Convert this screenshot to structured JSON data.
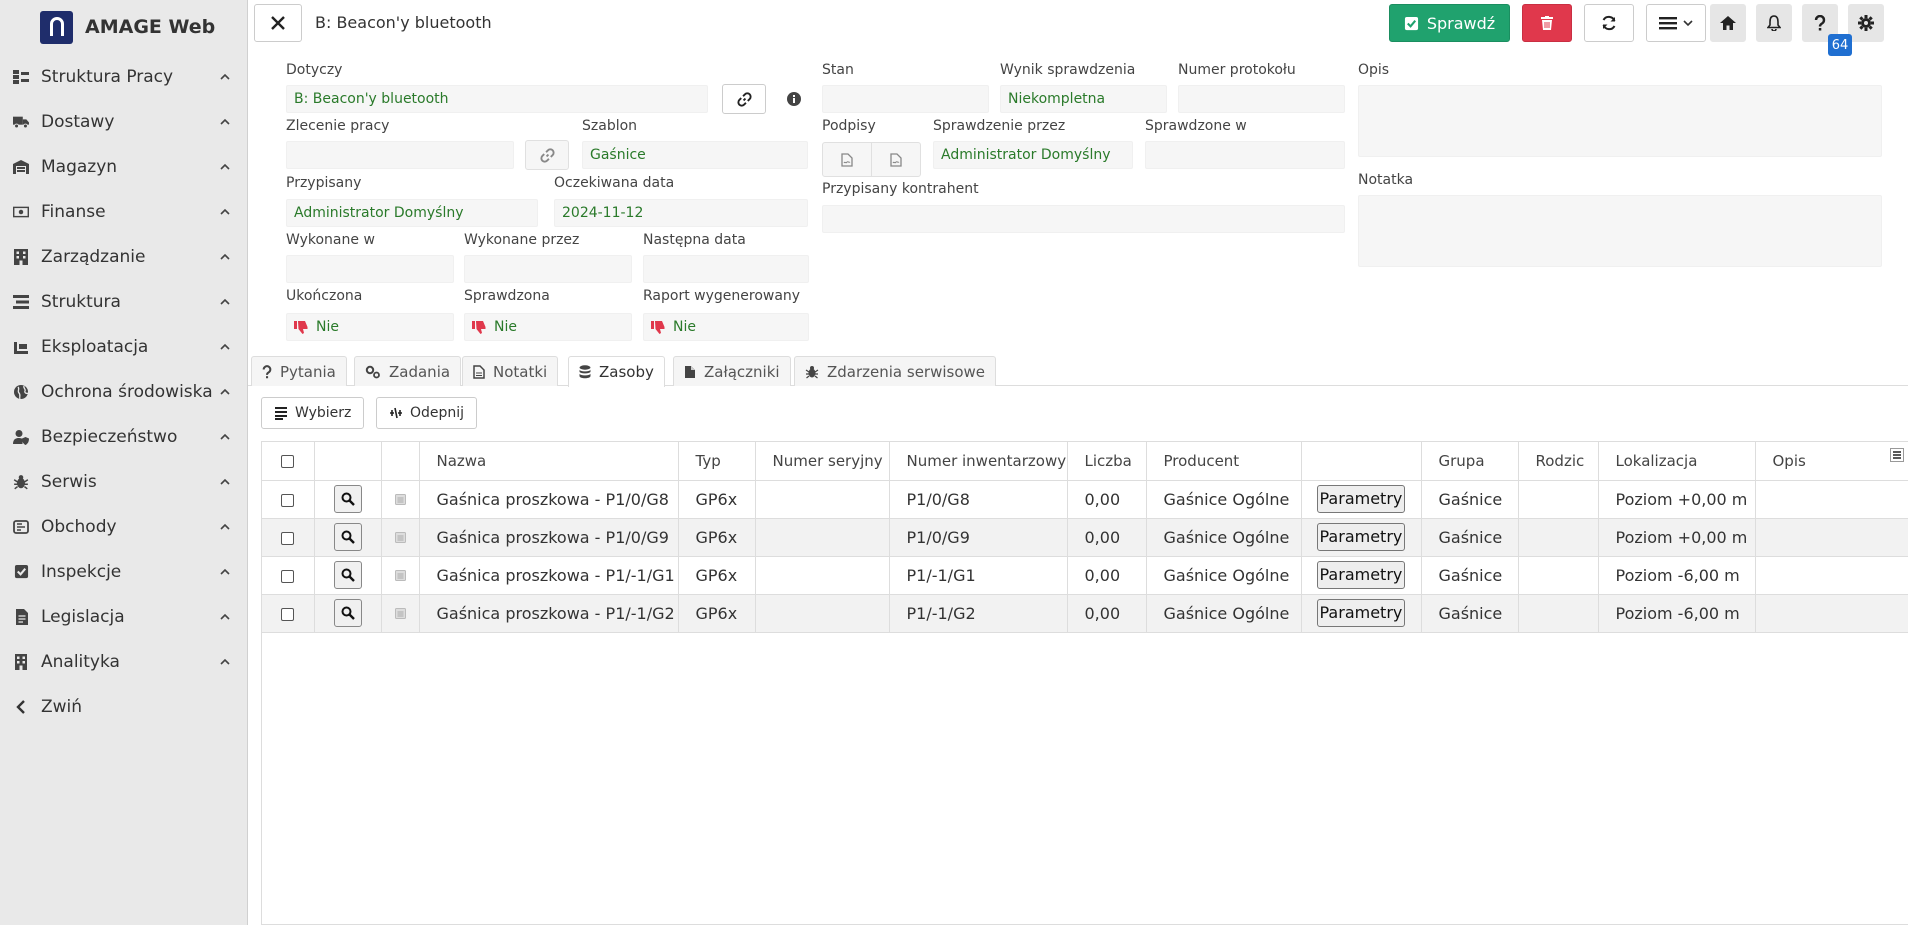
{
  "app": {
    "brand": "AMAGE Web"
  },
  "sidebar": {
    "items": [
      {
        "label": "Struktura Pracy",
        "icon": "sitemap-icon"
      },
      {
        "label": "Dostawy",
        "icon": "truck-icon"
      },
      {
        "label": "Magazyn",
        "icon": "warehouse-icon"
      },
      {
        "label": "Finanse",
        "icon": "money-icon"
      },
      {
        "label": "Zarządzanie",
        "icon": "building-icon"
      },
      {
        "label": "Struktura",
        "icon": "layers-icon"
      },
      {
        "label": "Eksploatacja",
        "icon": "gauge-icon"
      },
      {
        "label": "Ochrona środowiska",
        "icon": "globe-icon"
      },
      {
        "label": "Bezpieczeństwo",
        "icon": "user-shield-icon"
      },
      {
        "label": "Serwis",
        "icon": "bug-icon"
      },
      {
        "label": "Obchody",
        "icon": "route-icon"
      },
      {
        "label": "Inspekcje",
        "icon": "check-square-icon"
      },
      {
        "label": "Legislacja",
        "icon": "book-icon"
      },
      {
        "label": "Analityka",
        "icon": "chart-building-icon"
      }
    ],
    "collapse_label": "Zwiń"
  },
  "header": {
    "title": "B: Beacon'y bluetooth",
    "check_label": "Sprawdź",
    "badge_count": "64"
  },
  "form": {
    "dotyczy": {
      "label": "Dotyczy",
      "value": "B: Beacon'y bluetooth"
    },
    "zlecenie": {
      "label": "Zlecenie pracy",
      "value": ""
    },
    "szablon": {
      "label": "Szablon",
      "value": "Gaśnice"
    },
    "przypisany": {
      "label": "Przypisany",
      "value": "Administrator Domyślny"
    },
    "oczekiwana": {
      "label": "Oczekiwana data",
      "value": "2024-11-12"
    },
    "wykonane_w": {
      "label": "Wykonane w",
      "value": ""
    },
    "wykonane_przez": {
      "label": "Wykonane przez",
      "value": ""
    },
    "nastepna": {
      "label": "Następna data",
      "value": ""
    },
    "ukonczona": {
      "label": "Ukończona",
      "value": "Nie"
    },
    "sprawdzona": {
      "label": "Sprawdzona",
      "value": "Nie"
    },
    "raport": {
      "label": "Raport wygenerowany",
      "value": "Nie"
    },
    "stan": {
      "label": "Stan",
      "value": ""
    },
    "wynik": {
      "label": "Wynik sprawdzenia",
      "value": "Niekompletna"
    },
    "numer_protokolu": {
      "label": "Numer protokołu",
      "value": ""
    },
    "podpisy": {
      "label": "Podpisy"
    },
    "sprawdzenie_przez": {
      "label": "Sprawdzenie przez",
      "value": "Administrator Domyślny"
    },
    "sprawdzone_w": {
      "label": "Sprawdzone w",
      "value": ""
    },
    "kontrahent": {
      "label": "Przypisany kontrahent",
      "value": ""
    },
    "opis": {
      "label": "Opis",
      "value": ""
    },
    "notatka": {
      "label": "Notatka",
      "value": ""
    }
  },
  "tabs": [
    {
      "label": "Pytania",
      "icon": "question-icon"
    },
    {
      "label": "Zadania",
      "icon": "cogs-icon"
    },
    {
      "label": "Notatki",
      "icon": "file-text-icon"
    },
    {
      "label": "Zasoby",
      "icon": "database-icon",
      "active": true
    },
    {
      "label": "Załączniki",
      "icon": "file-icon"
    },
    {
      "label": "Zdarzenia serwisowe",
      "icon": "bug-icon"
    }
  ],
  "toolbar": {
    "select_label": "Wybierz",
    "unpin_label": "Odepnij"
  },
  "table": {
    "columns": [
      "Nazwa",
      "Typ",
      "Numer seryjny",
      "Numer inwentarzowy",
      "Liczba",
      "Producent",
      "",
      "Grupa",
      "Rodzic",
      "Lokalizacja",
      "Opis"
    ],
    "param_label": "Parametry",
    "rows": [
      {
        "nazwa": "Gaśnica proszkowa - P1/0/G8",
        "typ": "GP6x",
        "seryjny": "",
        "inwentarzowy": "P1/0/G8",
        "liczba": "0,00",
        "producent": "Gaśnice Ogólne",
        "grupa": "Gaśnice",
        "rodzic": "",
        "lokalizacja": "Poziom +0,00 m",
        "opis": ""
      },
      {
        "nazwa": "Gaśnica proszkowa - P1/0/G9",
        "typ": "GP6x",
        "seryjny": "",
        "inwentarzowy": "P1/0/G9",
        "liczba": "0,00",
        "producent": "Gaśnice Ogólne",
        "grupa": "Gaśnice",
        "rodzic": "",
        "lokalizacja": "Poziom +0,00 m",
        "opis": ""
      },
      {
        "nazwa": "Gaśnica proszkowa - P1/-1/G1",
        "typ": "GP6x",
        "seryjny": "",
        "inwentarzowy": "P1/-1/G1",
        "liczba": "0,00",
        "producent": "Gaśnice Ogólne",
        "grupa": "Gaśnice",
        "rodzic": "",
        "lokalizacja": "Poziom -6,00 m",
        "opis": ""
      },
      {
        "nazwa": "Gaśnica proszkowa - P1/-1/G2",
        "typ": "GP6x",
        "seryjny": "",
        "inwentarzowy": "P1/-1/G2",
        "liczba": "0,00",
        "producent": "Gaśnice Ogólne",
        "grupa": "Gaśnice",
        "rodzic": "",
        "lokalizacja": "Poziom -6,00 m",
        "opis": ""
      }
    ]
  },
  "colors": {
    "accent_green": "#20a26e",
    "danger": "#e0384c",
    "value_green": "#2a7a2a",
    "badge_blue": "#1f6fd1"
  }
}
